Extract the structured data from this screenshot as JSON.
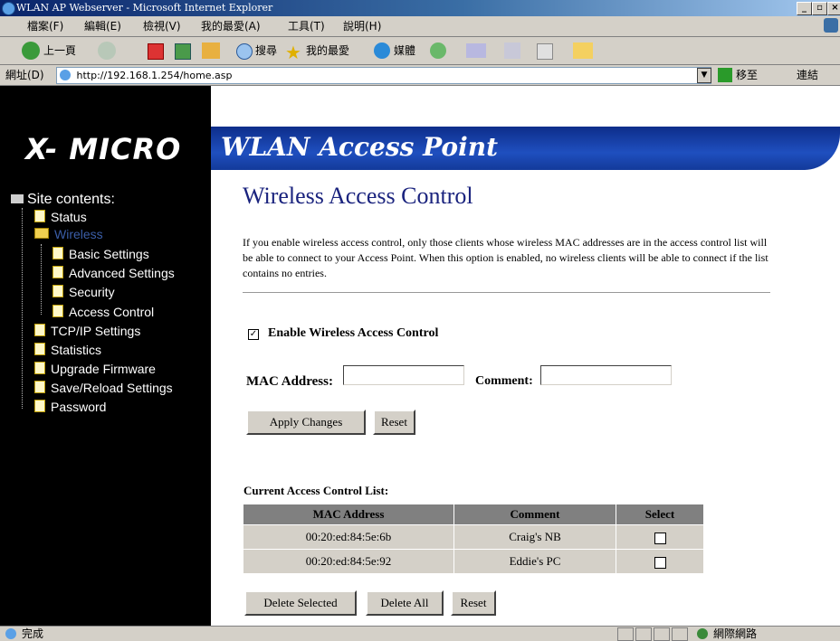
{
  "window": {
    "title": "WLAN AP Webserver - Microsoft Internet Explorer"
  },
  "menu": {
    "items": [
      "檔案(F)",
      "編輯(E)",
      "檢視(V)",
      "我的最愛(A)",
      "工具(T)",
      "說明(H)"
    ]
  },
  "toolbar": {
    "back_label": "上一頁",
    "search_label": "搜尋",
    "favorites_label": "我的最愛",
    "media_label": "媒體"
  },
  "address": {
    "label": "網址(D)",
    "url": "http://192.168.1.254/home.asp",
    "go_label": "移至",
    "links_label": "連結"
  },
  "banner": {
    "logo": "X- MICRO",
    "title": "WLAN Access Point"
  },
  "sidebar": {
    "header": "Site contents:",
    "items": [
      "Status",
      "Wireless",
      "Basic Settings",
      "Advanced Settings",
      "Security",
      "Access Control",
      "TCP/IP Settings",
      "Statistics",
      "Upgrade Firmware",
      "Save/Reload Settings",
      "Password"
    ],
    "active_color": "#3b5ea8"
  },
  "page": {
    "heading": "Wireless Access Control",
    "description": "If you enable wireless access control, only those clients whose wireless MAC addresses are in the access control list will be able to connect to your Access Point. When this option is enabled, no wireless clients will be able to connect if the list contains no entries.",
    "enable_label": "Enable Wireless Access Control",
    "enable_checked": true,
    "mac_label": "MAC Address:",
    "mac_value": "",
    "comment_label": "Comment:",
    "comment_value": "",
    "apply_label": "Apply Changes",
    "reset_label": "Reset",
    "list_title": "Current Access Control List:",
    "columns": [
      "MAC Address",
      "Comment",
      "Select"
    ],
    "rows": [
      {
        "mac": "00:20:ed:84:5e:6b",
        "comment": "Craig's NB"
      },
      {
        "mac": "00:20:ed:84:5e:92",
        "comment": "Eddie's PC"
      }
    ],
    "delete_selected_label": "Delete Selected",
    "delete_all_label": "Delete All",
    "reset2_label": "Reset"
  },
  "status": {
    "text": "完成",
    "zone": "網際網路"
  }
}
